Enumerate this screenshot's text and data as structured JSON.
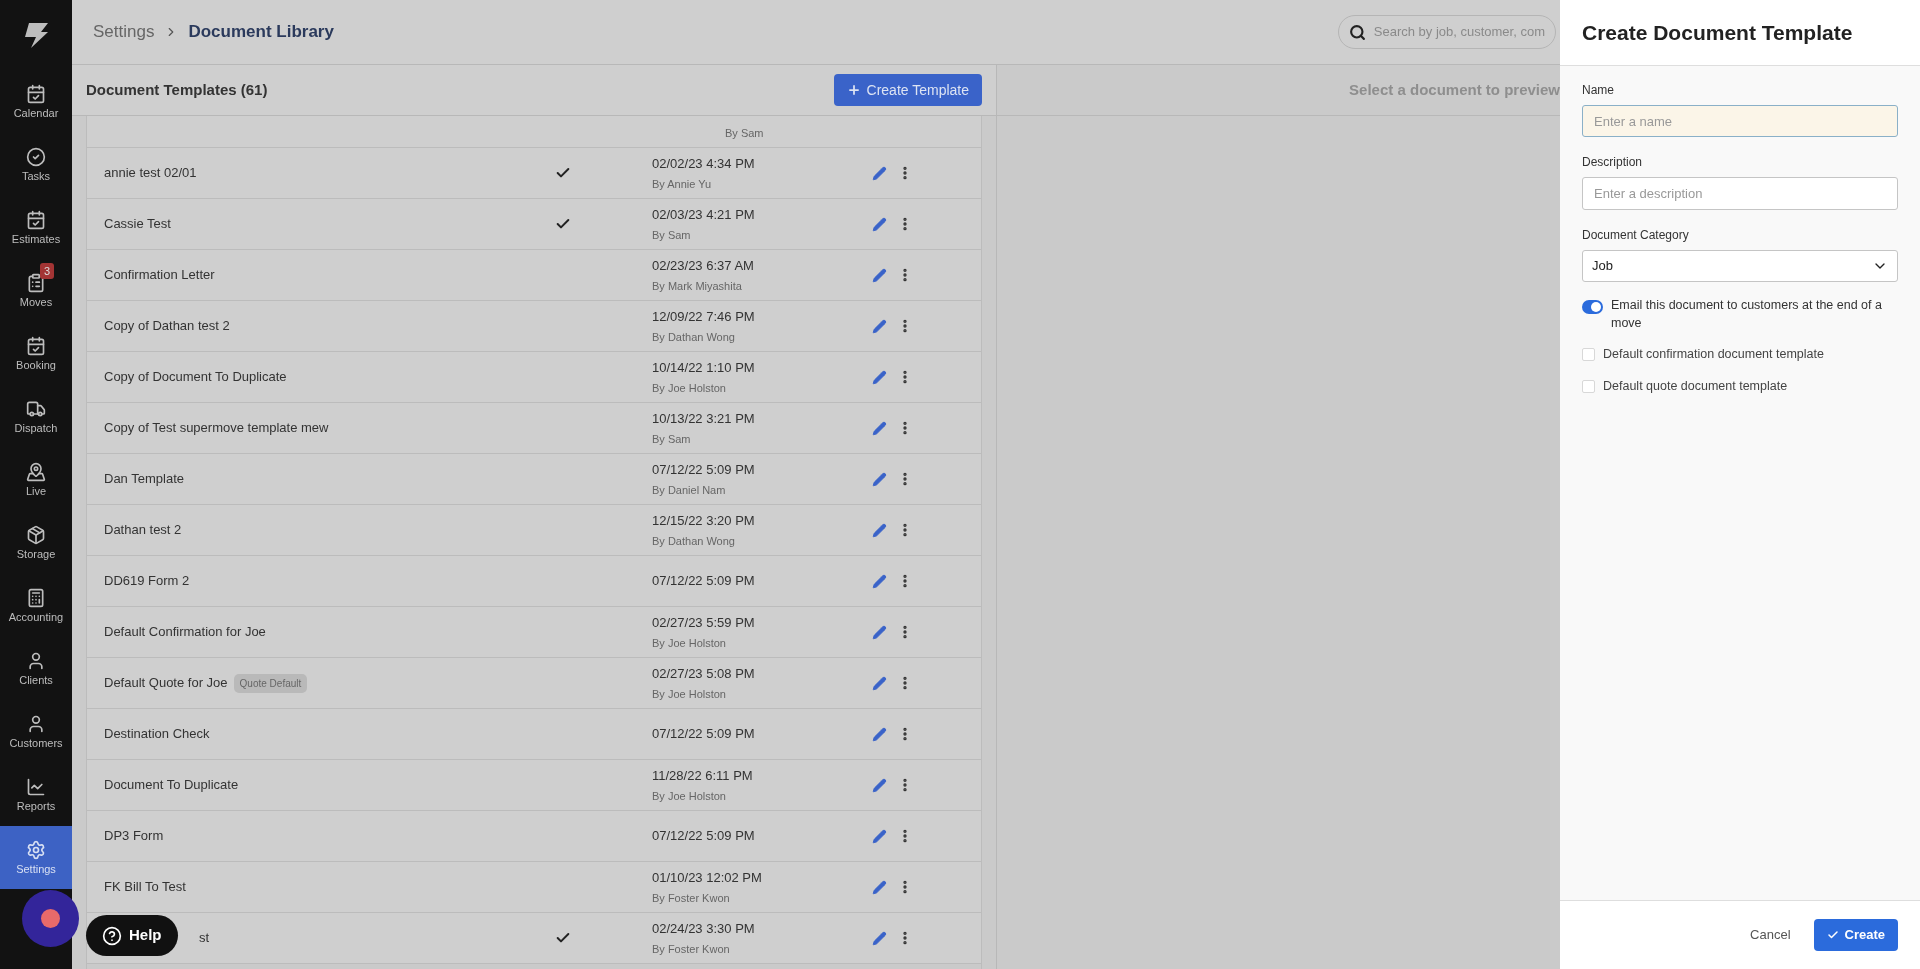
{
  "sidebar": {
    "items": [
      {
        "label": "Calendar",
        "selected": false
      },
      {
        "label": "Tasks",
        "selected": false
      },
      {
        "label": "Estimates",
        "selected": false
      },
      {
        "label": "Moves",
        "selected": false,
        "badge": "3"
      },
      {
        "label": "Booking",
        "selected": false
      },
      {
        "label": "Dispatch",
        "selected": false
      },
      {
        "label": "Live",
        "selected": false
      },
      {
        "label": "Storage",
        "selected": false
      },
      {
        "label": "Accounting",
        "selected": false
      },
      {
        "label": "Clients",
        "selected": false
      },
      {
        "label": "Customers",
        "selected": false
      },
      {
        "label": "Reports",
        "selected": false
      },
      {
        "label": "Settings",
        "selected": true
      }
    ]
  },
  "breadcrumb": {
    "parent": "Settings",
    "current": "Document Library"
  },
  "search": {
    "placeholder": "Search by job, customer, com"
  },
  "templates": {
    "title": "Document Templates (61)",
    "create_button": "Create Template",
    "rows": [
      {
        "kind": "partial",
        "author": "By Sam"
      },
      {
        "kind": "row",
        "name": "annie test 02/01",
        "checked": true,
        "date": "02/02/23 4:34 PM",
        "author": "By Annie Yu"
      },
      {
        "kind": "row",
        "name": "Cassie Test",
        "checked": true,
        "date": "02/03/23 4:21 PM",
        "author": "By Sam"
      },
      {
        "kind": "row",
        "name": "Confirmation Letter",
        "checked": false,
        "date": "02/23/23 6:37 AM",
        "author": "By Mark Miyashita"
      },
      {
        "kind": "row",
        "name": "Copy of Dathan test 2",
        "checked": false,
        "date": "12/09/22 7:46 PM",
        "author": "By Dathan Wong"
      },
      {
        "kind": "row",
        "name": "Copy of Document To Duplicate",
        "checked": false,
        "date": "10/14/22 1:10 PM",
        "author": "By Joe Holston"
      },
      {
        "kind": "row",
        "name": "Copy of Test supermove template mew",
        "checked": false,
        "date": "10/13/22 3:21 PM",
        "author": "By Sam"
      },
      {
        "kind": "row",
        "name": "Dan Template",
        "checked": false,
        "date": "07/12/22 5:09 PM",
        "author": "By Daniel Nam"
      },
      {
        "kind": "row",
        "name": "Dathan test 2",
        "checked": false,
        "date": "12/15/22 3:20 PM",
        "author": "By Dathan Wong"
      },
      {
        "kind": "row",
        "name": "DD619 Form 2",
        "checked": false,
        "date": "07/12/22 5:09 PM"
      },
      {
        "kind": "row",
        "name": "Default Confirmation for Joe",
        "checked": false,
        "date": "02/27/23 5:59 PM",
        "author": "By Joe Holston"
      },
      {
        "kind": "row",
        "name": "Default Quote for Joe",
        "tag": "Quote Default",
        "checked": false,
        "date": "02/27/23 5:08 PM",
        "author": "By Joe Holston"
      },
      {
        "kind": "row",
        "name": "Destination Check",
        "checked": false,
        "date": "07/12/22 5:09 PM"
      },
      {
        "kind": "row",
        "name": "Document To Duplicate",
        "checked": false,
        "date": "11/28/22 6:11 PM",
        "author": "By Joe Holston"
      },
      {
        "kind": "row",
        "name": "DP3 Form",
        "checked": false,
        "date": "07/12/22 5:09 PM"
      },
      {
        "kind": "row",
        "name": "FK Bill To Test",
        "checked": false,
        "date": "01/10/23 12:02 PM",
        "author": "By Foster Kwon"
      },
      {
        "kind": "covered_row",
        "name": "st",
        "checked": true,
        "date": "02/24/23 3:30 PM",
        "author": "By Foster Kwon"
      }
    ]
  },
  "preview": {
    "message": "Select a document to preview"
  },
  "help_button": "Help",
  "drawer": {
    "title": "Create Document Template",
    "name": {
      "label": "Name",
      "placeholder": "Enter a name"
    },
    "description": {
      "label": "Description",
      "placeholder": "Enter a description"
    },
    "category": {
      "label": "Document Category",
      "value": "Job"
    },
    "email_toggle": {
      "label": "Email this document to customers at the end of a move",
      "on": true
    },
    "checkboxes": [
      {
        "label": "Default confirmation document template",
        "checked": false
      },
      {
        "label": "Default quote document template",
        "checked": false
      }
    ],
    "cancel_button": "Cancel",
    "create_button": "Create"
  }
}
